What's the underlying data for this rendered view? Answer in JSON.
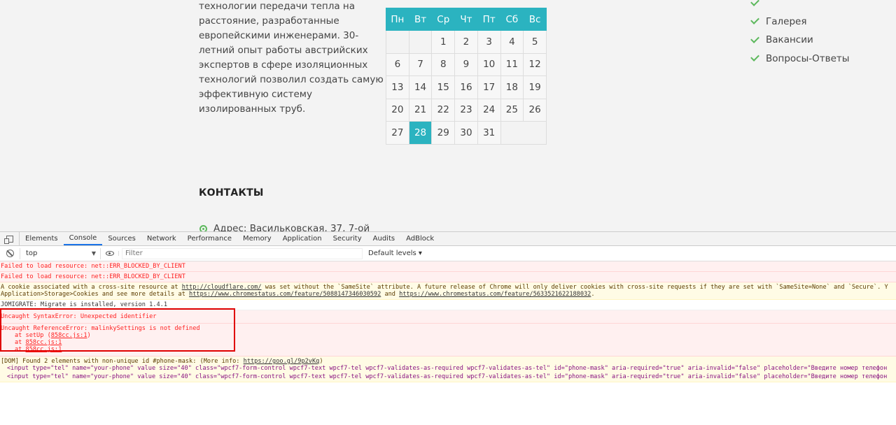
{
  "site": {
    "about_lines": [
      "технологии передачи тепла на",
      "расстояние, разработанные",
      "европейскими инженерами. 30-",
      "летний опыт работы австрийских",
      "экспертов в сфере изоляционных",
      "технологий позволил создать самую",
      "эффективную систему",
      "изолированных труб."
    ],
    "calendar": {
      "weekdays": [
        "Пн",
        "Вт",
        "Ср",
        "Чт",
        "Пт",
        "Сб",
        "Вс"
      ],
      "weeks": [
        [
          "",
          "",
          "1",
          "2",
          "3",
          "4",
          "5"
        ],
        [
          "6",
          "7",
          "8",
          "9",
          "10",
          "11",
          "12"
        ],
        [
          "13",
          "14",
          "15",
          "16",
          "17",
          "18",
          "19"
        ],
        [
          "20",
          "21",
          "22",
          "23",
          "24",
          "25",
          "26"
        ],
        [
          "27",
          "28",
          "29",
          "30",
          "31",
          "",
          ""
        ]
      ],
      "today": "28"
    },
    "menu": [
      "Галерея",
      "Вакансии",
      "Вопросы-Ответы"
    ],
    "contacts_title": "КОНТАКТЫ",
    "address": "Адрес: Васильковская, 37, 7-ой"
  },
  "devtools": {
    "tabs": [
      "Elements",
      "Console",
      "Sources",
      "Network",
      "Performance",
      "Memory",
      "Application",
      "Security",
      "Audits",
      "AdBlock"
    ],
    "active_tab": "Console",
    "context": "top",
    "filter_placeholder": "Filter",
    "levels": "Default levels ▾",
    "messages": {
      "blocked1": "Failed to load resource: net::ERR_BLOCKED_BY_CLIENT",
      "blocked2": "Failed to load resource: net::ERR_BLOCKED_BY_CLIENT",
      "cookie_a": "A cookie associated with a cross-site resource at ",
      "cookie_link1": "http://cloudflare.com/",
      "cookie_b": " was set without the `SameSite` attribute. A future release of Chrome will only deliver cookies with cross-site requests if they are set with `SameSite=None` and `Secure`. Y",
      "cookie_c": "Application>Storage>Cookies and see more details at ",
      "cookie_link2": "https://www.chromestatus.com/feature/5088147346030592",
      "cookie_and": " and ",
      "cookie_link3": "https://www.chromestatus.com/feature/5633521622188032",
      "cookie_end": ".",
      "migrate": "JOMIGRATE: Migrate is installed, version 1.4.1",
      "syntax": "Uncaught SyntaxError: Unexpected identifier",
      "reference": "Uncaught ReferenceError: malinkySettings is not defined",
      "stack1_pre": "at setUp (",
      "stack1_link": "858cc.js:1",
      "stack1_post": ")",
      "stack2_pre": "at ",
      "stack2_link": "858cc.js:1",
      "stack3_pre": "at ",
      "stack3_link": "858cc.js:1",
      "dom_a": "[DOM] Found 2 elements with non-unique id #phone-mask: (More info: ",
      "dom_link": "https://goo.gl/9p2vKq",
      "dom_b": ")",
      "input_line1": "<input type=\"tel\" name=\"your-phone\" value size=\"40\" class=\"wpcf7-form-control wpcf7-text wpcf7-tel wpcf7-validates-as-required wpcf7-validates-as-tel\" id=\"phone-mask\" aria-required=\"true\" aria-invalid=\"false\" placeholder=\"Введите номер телефон",
      "input_line2": "<input type=\"tel\" name=\"your-phone\" value size=\"40\" class=\"wpcf7-form-control wpcf7-text wpcf7-tel wpcf7-validates-as-required wpcf7-validates-as-tel\" id=\"phone-mask\" aria-required=\"true\" aria-invalid=\"false\" placeholder=\"Введите номер телефон"
    }
  },
  "colors": {
    "accent": "#2bb3c0",
    "check": "#5cb85c",
    "error": "#ff1f1f",
    "highlight_box": "#e00000"
  }
}
